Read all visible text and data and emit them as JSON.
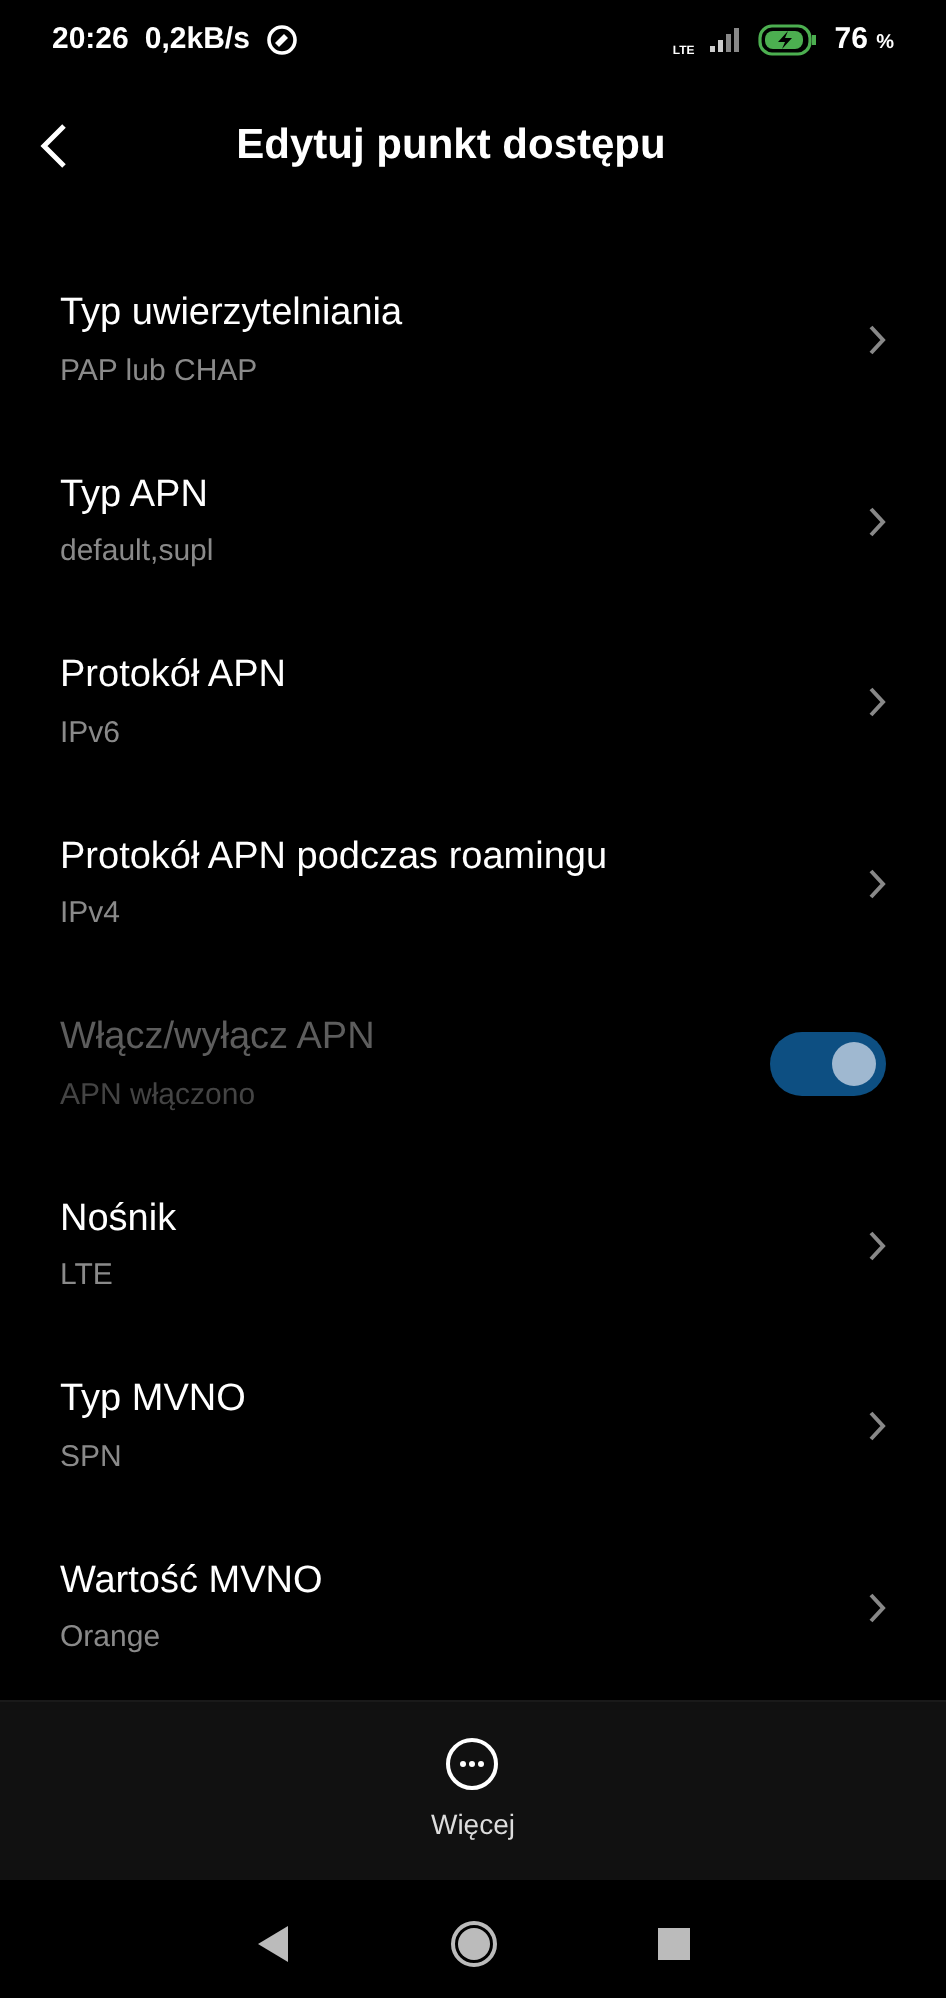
{
  "status_bar": {
    "time": "20:26",
    "speed": "0,2kB/s",
    "network": "LTE",
    "battery": "76",
    "battery_unit": "%"
  },
  "header": {
    "title": "Edytuj punkt dostępu"
  },
  "items": [
    {
      "kind": "link",
      "title": "Typ uwierzytelniania",
      "value": "PAP lub CHAP",
      "disabled": false
    },
    {
      "kind": "link",
      "title": "Typ APN",
      "value": "default,supl",
      "disabled": false
    },
    {
      "kind": "link",
      "title": "Protokół APN",
      "value": "IPv6",
      "disabled": false
    },
    {
      "kind": "link",
      "title": "Protokół APN podczas roamingu",
      "value": "IPv4",
      "disabled": false
    },
    {
      "kind": "switch",
      "title": "Włącz/wyłącz APN",
      "value": "APN włączono",
      "disabled": true,
      "on": true
    },
    {
      "kind": "link",
      "title": "Nośnik",
      "value": "LTE",
      "disabled": false
    },
    {
      "kind": "link",
      "title": "Typ MVNO",
      "value": "SPN",
      "disabled": false
    },
    {
      "kind": "link",
      "title": "Wartość MVNO",
      "value": "Orange",
      "disabled": false
    }
  ],
  "bottom_bar": {
    "label": "Więcej"
  }
}
